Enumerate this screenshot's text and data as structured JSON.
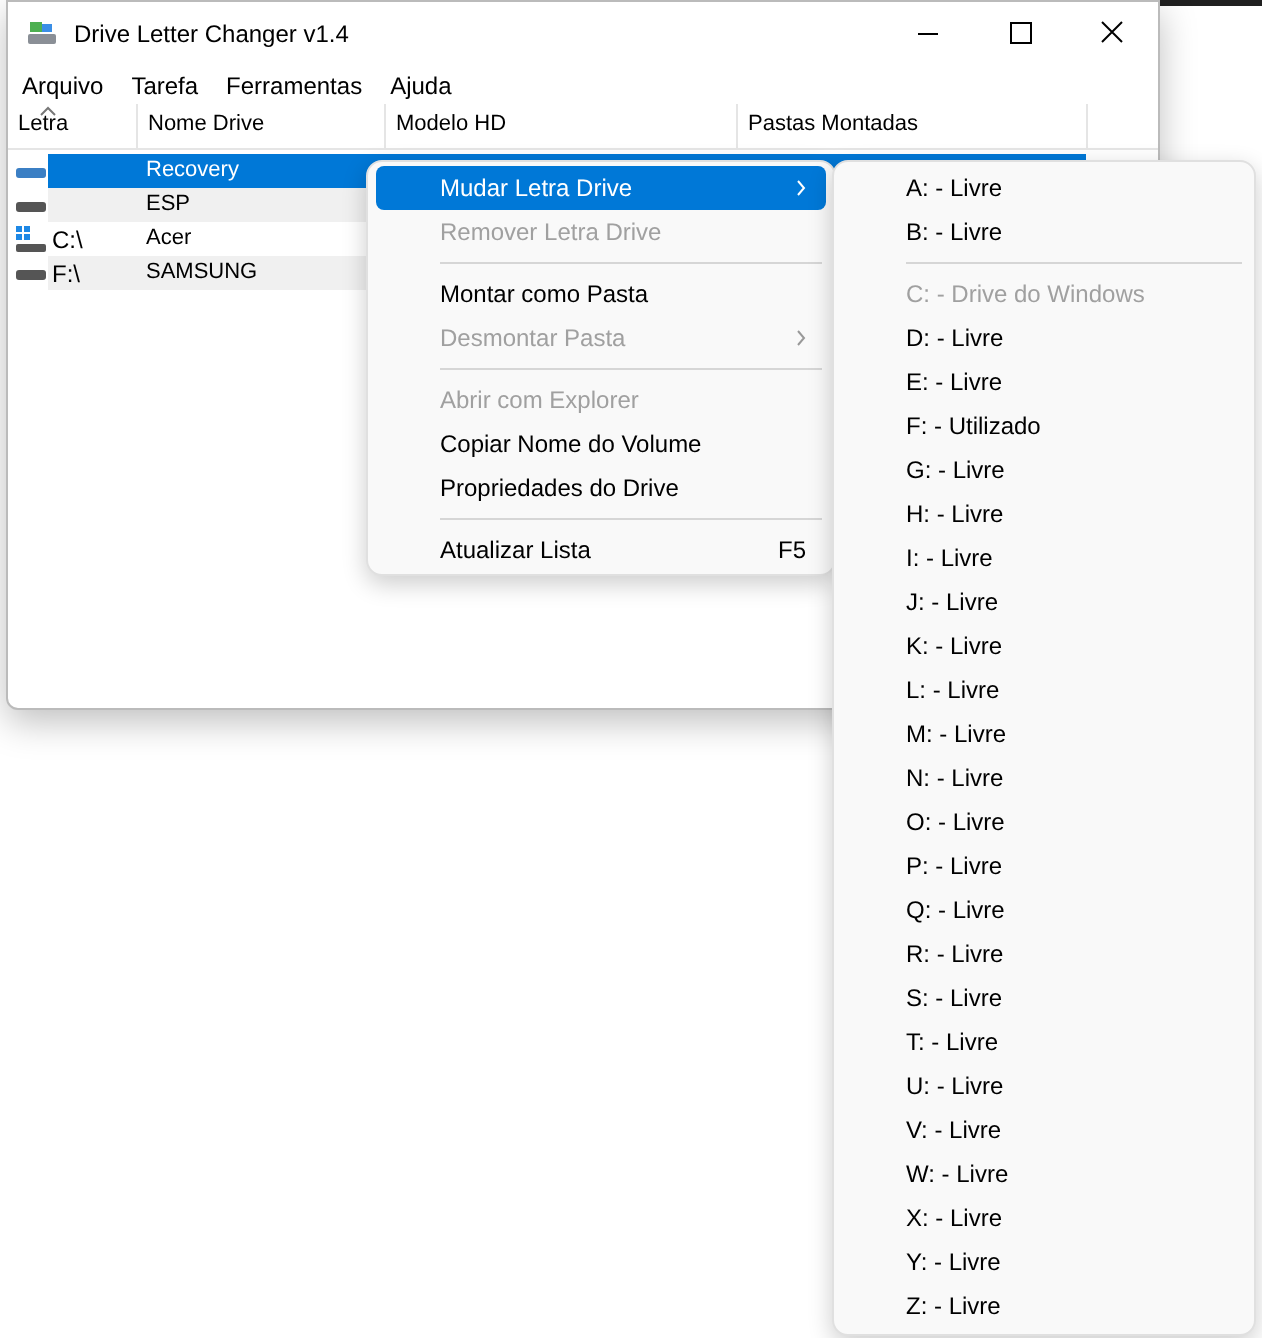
{
  "window": {
    "title": "Drive Letter Changer v1.4"
  },
  "menu_bar": [
    "Arquivo",
    "Tarefa",
    "Ferramentas",
    "Ajuda"
  ],
  "table": {
    "columns": [
      {
        "label": "Letra",
        "sorted": true
      },
      {
        "label": "Nome Drive",
        "sorted": false
      },
      {
        "label": "Modelo HD",
        "sorted": false
      },
      {
        "label": "Pastas Montadas",
        "sorted": false
      }
    ],
    "rows": [
      {
        "kind": "drive",
        "letter": "",
        "name": "Recovery",
        "selected": true
      },
      {
        "kind": "drive",
        "letter": "",
        "name": "ESP",
        "selected": false
      },
      {
        "kind": "system",
        "letter": "C:\\",
        "name": "Acer",
        "selected": false
      },
      {
        "kind": "drive",
        "letter": "F:\\",
        "name": "SAMSUNG",
        "selected": false
      }
    ]
  },
  "context_menu": [
    {
      "kind": "item",
      "label": "Mudar Letra Drive",
      "selected": true,
      "disabled": false,
      "submenu": true
    },
    {
      "kind": "item",
      "label": "Remover Letra Drive",
      "selected": false,
      "disabled": true,
      "submenu": false
    },
    {
      "kind": "separator"
    },
    {
      "kind": "item",
      "label": "Montar como Pasta",
      "selected": false,
      "disabled": false,
      "submenu": false
    },
    {
      "kind": "item",
      "label": "Desmontar Pasta",
      "selected": false,
      "disabled": true,
      "submenu": true
    },
    {
      "kind": "separator"
    },
    {
      "kind": "item",
      "label": "Abrir com Explorer",
      "selected": false,
      "disabled": true,
      "submenu": false
    },
    {
      "kind": "item",
      "label": "Copiar Nome do Volume",
      "selected": false,
      "disabled": false,
      "submenu": false
    },
    {
      "kind": "item",
      "label": "Propriedades do Drive",
      "selected": false,
      "disabled": false,
      "submenu": false
    },
    {
      "kind": "separator"
    },
    {
      "kind": "item",
      "label": "Atualizar Lista",
      "selected": false,
      "disabled": false,
      "submenu": false,
      "shortcut": "F5"
    }
  ],
  "submenu": [
    {
      "kind": "item",
      "label": "A: - Livre",
      "disabled": false
    },
    {
      "kind": "item",
      "label": "B: - Livre",
      "disabled": false
    },
    {
      "kind": "separator"
    },
    {
      "kind": "item",
      "label": "C: - Drive do Windows",
      "disabled": true
    },
    {
      "kind": "item",
      "label": "D: - Livre",
      "disabled": false
    },
    {
      "kind": "item",
      "label": "E: - Livre",
      "disabled": false
    },
    {
      "kind": "item",
      "label": "F: - Utilizado",
      "disabled": false
    },
    {
      "kind": "item",
      "label": "G: - Livre",
      "disabled": false
    },
    {
      "kind": "item",
      "label": "H: - Livre",
      "disabled": false
    },
    {
      "kind": "item",
      "label": "I: - Livre",
      "disabled": false
    },
    {
      "kind": "item",
      "label": "J: - Livre",
      "disabled": false
    },
    {
      "kind": "item",
      "label": "K: - Livre",
      "disabled": false
    },
    {
      "kind": "item",
      "label": "L: - Livre",
      "disabled": false
    },
    {
      "kind": "item",
      "label": "M: - Livre",
      "disabled": false
    },
    {
      "kind": "item",
      "label": "N: - Livre",
      "disabled": false
    },
    {
      "kind": "item",
      "label": "O: - Livre",
      "disabled": false
    },
    {
      "kind": "item",
      "label": "P: - Livre",
      "disabled": false
    },
    {
      "kind": "item",
      "label": "Q: - Livre",
      "disabled": false
    },
    {
      "kind": "item",
      "label": "R: - Livre",
      "disabled": false
    },
    {
      "kind": "item",
      "label": "S: - Livre",
      "disabled": false
    },
    {
      "kind": "item",
      "label": "T: - Livre",
      "disabled": false
    },
    {
      "kind": "item",
      "label": "U: - Livre",
      "disabled": false
    },
    {
      "kind": "item",
      "label": "V: - Livre",
      "disabled": false
    },
    {
      "kind": "item",
      "label": "W: - Livre",
      "disabled": false
    },
    {
      "kind": "item",
      "label": "X: - Livre",
      "disabled": false
    },
    {
      "kind": "item",
      "label": "Y: - Livre",
      "disabled": false
    },
    {
      "kind": "item",
      "label": "Z: - Livre",
      "disabled": false
    }
  ]
}
